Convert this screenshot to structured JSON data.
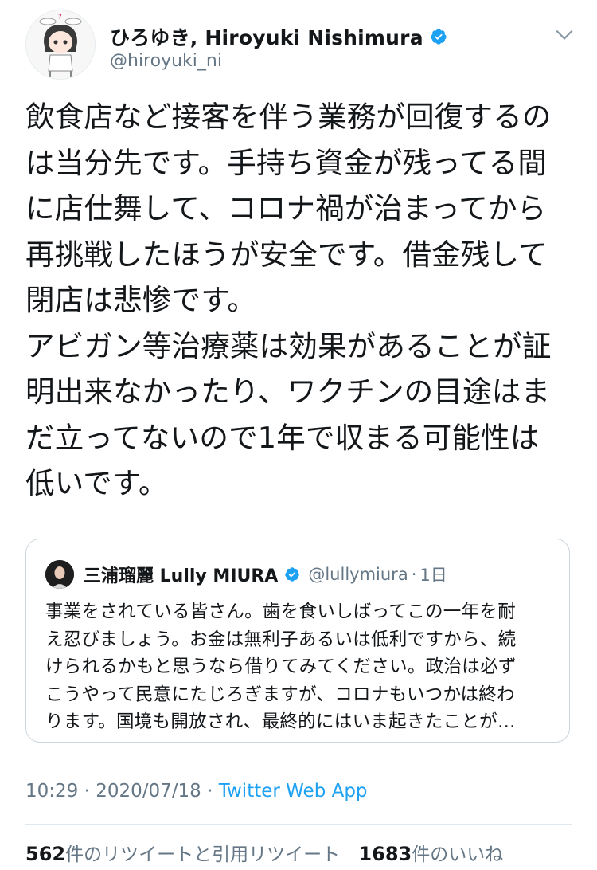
{
  "author": {
    "display_name": "ひろゆき, Hiroyuki Nishimura",
    "handle": "@hiroyuki_ni",
    "verified": true
  },
  "tweet": {
    "text": "飲食店など接客を伴う業務が回復するの\nは当分先です。手持ち資金が残ってる間\nに店仕舞して、コロナ禍が治まってから\n再挑戦したほうが安全です。借金残して\n閉店は悲惨です。\nアビガン等治療薬は効果があることが証\n明出来なかったり、ワクチンの目途はま\nだ立ってないので1年で収まる可能性は\n低いです。"
  },
  "quoted_tweet": {
    "display_name": "三浦瑠麗 Lully MIURA",
    "handle": "@lullymiura",
    "separator": "·",
    "time": "1日",
    "text": "事業をされている皆さん。歯を食いしばってこの一年を耐\nえ忍びましょう。お金は無利子あるいは低利ですから、続\nけられるかもと思うなら借りてみてください。政治は必ず\nこうやって民意にたじろぎますが、コロナもいつかは終わ\nります。国境も開放され、最終的にはいま起きたことが…"
  },
  "meta": {
    "time": "10:29",
    "separator1": " · ",
    "date": "2020/07/18",
    "separator2": " · ",
    "source": "Twitter Web App"
  },
  "stats": {
    "retweets": "562",
    "retweets_label": "件のリツイートと引用リツイート",
    "likes": "1683",
    "likes_label": "件のいいね"
  },
  "colors": {
    "accent": "#1da1f2",
    "secondary_text": "#657786",
    "border": "#ccd6dd"
  }
}
